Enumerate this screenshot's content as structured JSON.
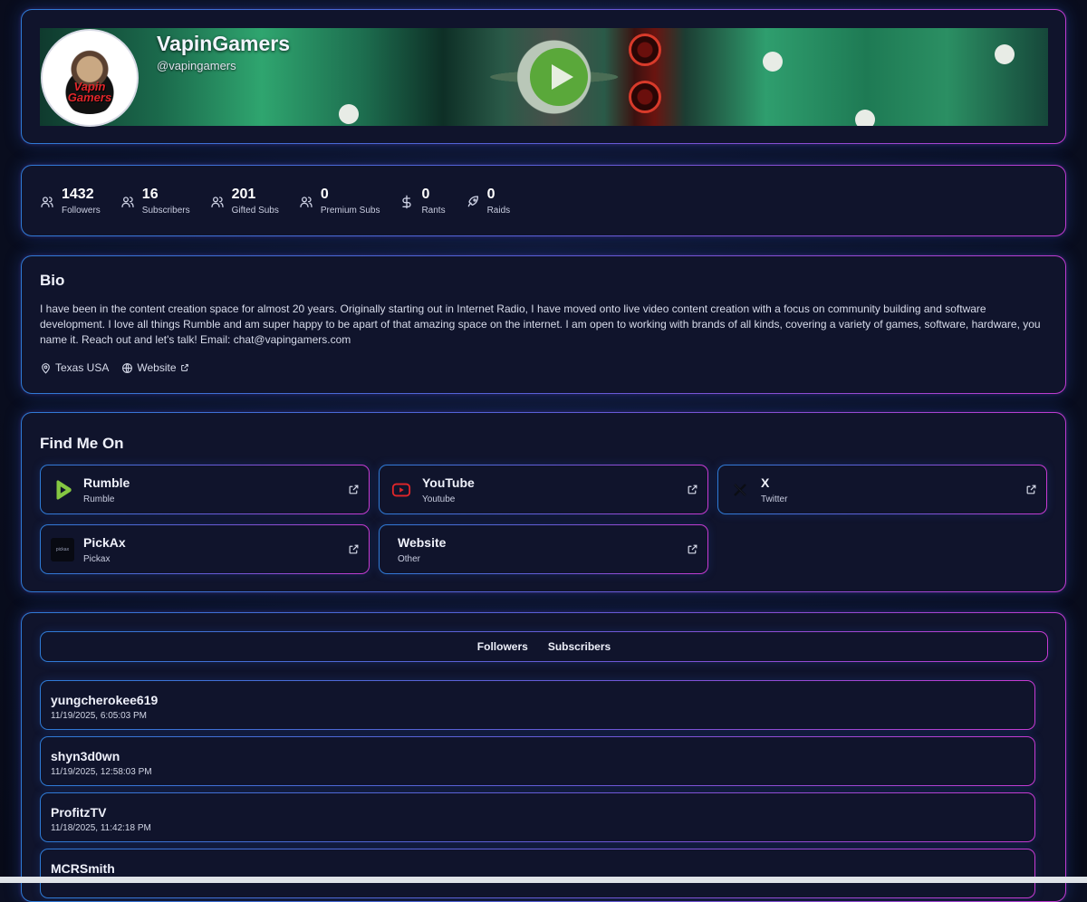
{
  "profile": {
    "name": "VapinGamers",
    "handle": "@vapingamers",
    "avatar_text": "Vapin Gamers"
  },
  "stats": [
    {
      "value": "1432",
      "label": "Followers",
      "icon": "users-icon"
    },
    {
      "value": "16",
      "label": "Subscribers",
      "icon": "users-icon"
    },
    {
      "value": "201",
      "label": "Gifted Subs",
      "icon": "users-icon"
    },
    {
      "value": "0",
      "label": "Premium Subs",
      "icon": "users-icon"
    },
    {
      "value": "0",
      "label": "Rants",
      "icon": "dollar-icon"
    },
    {
      "value": "0",
      "label": "Raids",
      "icon": "rocket-icon"
    }
  ],
  "bio": {
    "title": "Bio",
    "text": "I have been in the content creation space for almost 20 years. Originally starting out in Internet Radio, I have moved onto live video content creation with a focus on community building and software development. I love all things Rumble and am super happy to be apart of that amazing space on the internet. I am open to working with brands of all kinds, covering a variety of games, software, hardware, you name it. Reach out and let's talk! Email: chat@vapingamers.com",
    "location": "Texas USA",
    "website_label": "Website"
  },
  "findme": {
    "title": "Find Me On",
    "links": [
      {
        "name": "Rumble",
        "sub": "Rumble",
        "icon": "rumble-icon"
      },
      {
        "name": "YouTube",
        "sub": "Youtube",
        "icon": "youtube-icon"
      },
      {
        "name": "X",
        "sub": "Twitter",
        "icon": "x-icon"
      },
      {
        "name": "PickAx",
        "sub": "Pickax",
        "icon": "pickax-icon",
        "icon_text": "pickax"
      },
      {
        "name": "Website",
        "sub": "Other",
        "icon": ""
      }
    ]
  },
  "tabs": [
    "Followers",
    "Subscribers"
  ],
  "users": [
    {
      "name": "yungcherokee619",
      "time": "11/19/2025, 6:05:03 PM"
    },
    {
      "name": "shyn3d0wn",
      "time": "11/19/2025, 12:58:03 PM"
    },
    {
      "name": "ProfitzTV",
      "time": "11/18/2025, 11:42:18 PM"
    },
    {
      "name": "MCRSmith",
      "time": ""
    }
  ],
  "colors": {
    "background": "#0b0f22",
    "card": "#10142c",
    "border_start": "#2e7bd6",
    "border_end": "#c03bd0",
    "rumble_green": "#85c742",
    "youtube_red": "#e0262a"
  }
}
